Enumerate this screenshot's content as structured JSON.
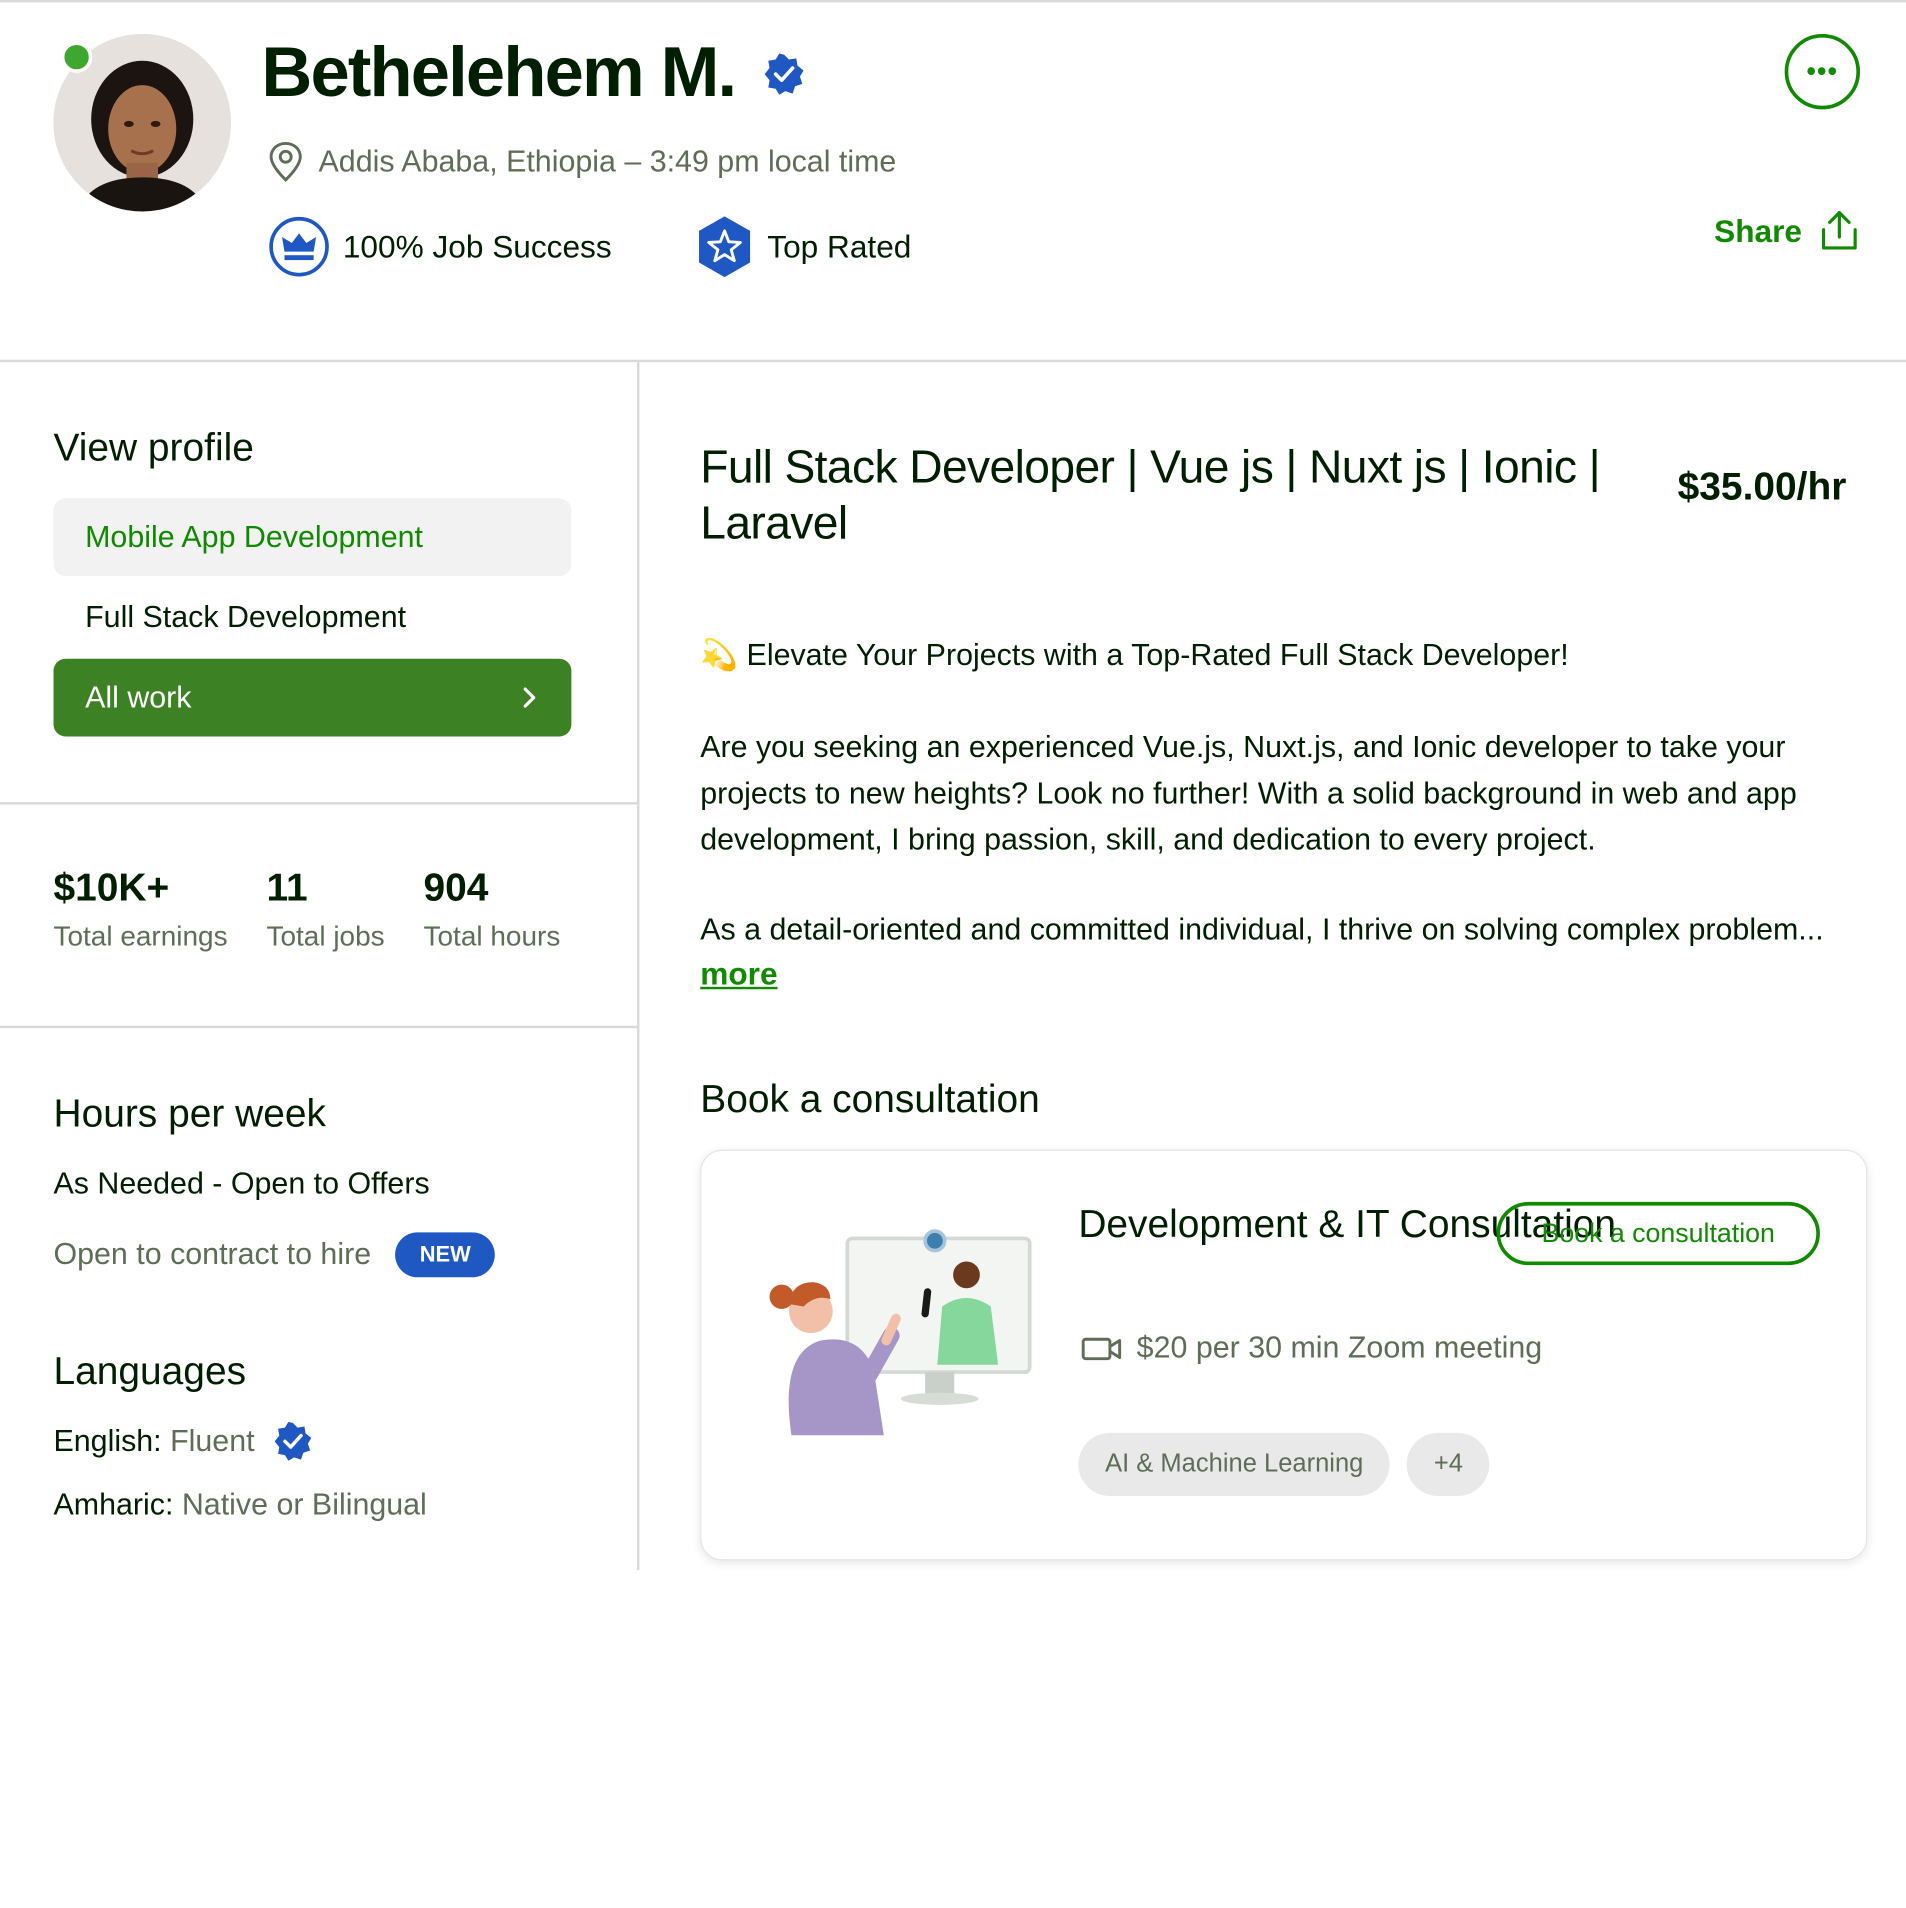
{
  "profile": {
    "name": "Bethelehem M.",
    "location": "Addis Ababa, Ethiopia – 3:49 pm local time",
    "job_success": "100% Job Success",
    "top_rated": "Top Rated",
    "share_label": "Share",
    "more_label": "•••"
  },
  "sidebar": {
    "view_profile_title": "View profile",
    "items": [
      {
        "label": "Mobile App Development",
        "active": true
      },
      {
        "label": "Full Stack Development",
        "active": false
      }
    ],
    "all_work_label": "All work",
    "stats": [
      {
        "value": "$10K+",
        "label": "Total earnings"
      },
      {
        "value": "11",
        "label": "Total jobs"
      },
      {
        "value": "904",
        "label": "Total hours"
      }
    ],
    "hours_title": "Hours per week",
    "availability": "As Needed - Open to Offers",
    "contract_to_hire": "Open to contract to hire",
    "new_badge": "NEW",
    "languages_title": "Languages",
    "languages": [
      {
        "name": "English:",
        "level": "Fluent",
        "verified": true
      },
      {
        "name": "Amharic:",
        "level": "Native or Bilingual",
        "verified": false
      }
    ]
  },
  "main": {
    "title": "Full Stack Developer | Vue js | Nuxt js | Ionic | Laravel",
    "rate": "$35.00/hr",
    "intro": "Elevate Your Projects with a Top-Rated Full Stack Developer!",
    "intro_emoji": "💫",
    "para1": "Are you seeking an experienced Vue.js, Nuxt.js, and Ionic developer to take your projects to new heights? Look no further! With a solid background in web and app development, I bring passion, skill, and dedication to every project.",
    "para2": "As a detail-oriented and committed individual, I thrive on solving complex problem...",
    "more_label": "more",
    "consultation_heading": "Book a consultation",
    "consultation": {
      "title": "Development & IT Consultation",
      "button": "Book a consultation",
      "price": "$20 per 30 min Zoom meeting",
      "tags": [
        "AI & Machine Learning",
        "+4"
      ]
    }
  },
  "colors": {
    "brand_green": "#108a00",
    "button_green": "#3c8224",
    "badge_blue": "#1f57c3",
    "online": "#3ea72f"
  }
}
